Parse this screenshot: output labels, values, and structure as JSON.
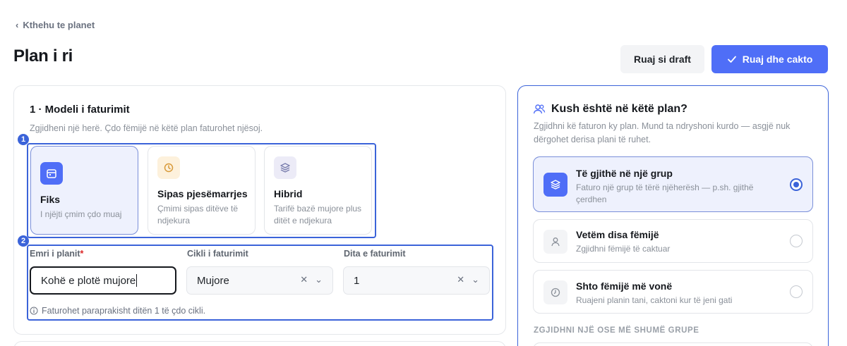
{
  "nav": {
    "back_label": "Kthehu te planet"
  },
  "page": {
    "title": "Plan i ri"
  },
  "actions": {
    "draft_label": "Ruaj si draft",
    "save_label": "Ruaj dhe cakto"
  },
  "billing": {
    "section_title": "1 · Modeli i faturimit",
    "section_subtitle": "Zgjidheni një herë. Çdo fëmijë në këtë plan faturohet njësoj.",
    "options": [
      {
        "name": "Fiks",
        "desc": "I njëjti çmim çdo muaj",
        "icon": "calendar-icon",
        "selected": true
      },
      {
        "name": "Sipas pjesëmarrjes",
        "desc": "Çmimi sipas ditëve të ndjekura",
        "icon": "clock-icon",
        "selected": false
      },
      {
        "name": "Hibrid",
        "desc": "Tarifë bazë mujore plus ditët e ndjekura",
        "icon": "layers-icon",
        "selected": false
      }
    ],
    "fields": {
      "plan_name_label": "Emri i planit",
      "plan_name_required": "*",
      "plan_name_value": "Kohë e plotë mujore",
      "cycle_label": "Cikli i faturimit",
      "cycle_value": "Mujore",
      "day_label": "Dita e faturimit",
      "day_value": "1"
    },
    "hint": "Faturohet paraprakisht ditën 1 të çdo cikli."
  },
  "annotations": {
    "badge_1": "1",
    "badge_2": "2"
  },
  "who": {
    "title": "Kush është në këtë plan?",
    "subtitle": "Zgjidhni kë faturon ky plan. Mund ta ndryshoni kurdo — asgjë nuk dërgohet derisa plani të ruhet.",
    "options": [
      {
        "name": "Të gjithë në një grup",
        "desc": "Faturo një grup të tërë njëherësh — p.sh. gjithë çerdhen",
        "icon": "layers-icon",
        "selected": true
      },
      {
        "name": "Vetëm disa fëmijë",
        "desc": "Zgjidhni fëmijë të caktuar",
        "icon": "person-icon",
        "selected": false
      },
      {
        "name": "Shto fëmijë më vonë",
        "desc": "Ruajeni planin tani, caktoni kur të jeni gati",
        "icon": "clock-icon",
        "selected": false
      }
    ],
    "groups_header": "ZGJIDHNI NJË OSE MË SHUMË GRUPE"
  },
  "colors": {
    "accent": "#4f6ef7",
    "highlight": "#3b63d9",
    "selected_bg": "#eef1fd"
  }
}
